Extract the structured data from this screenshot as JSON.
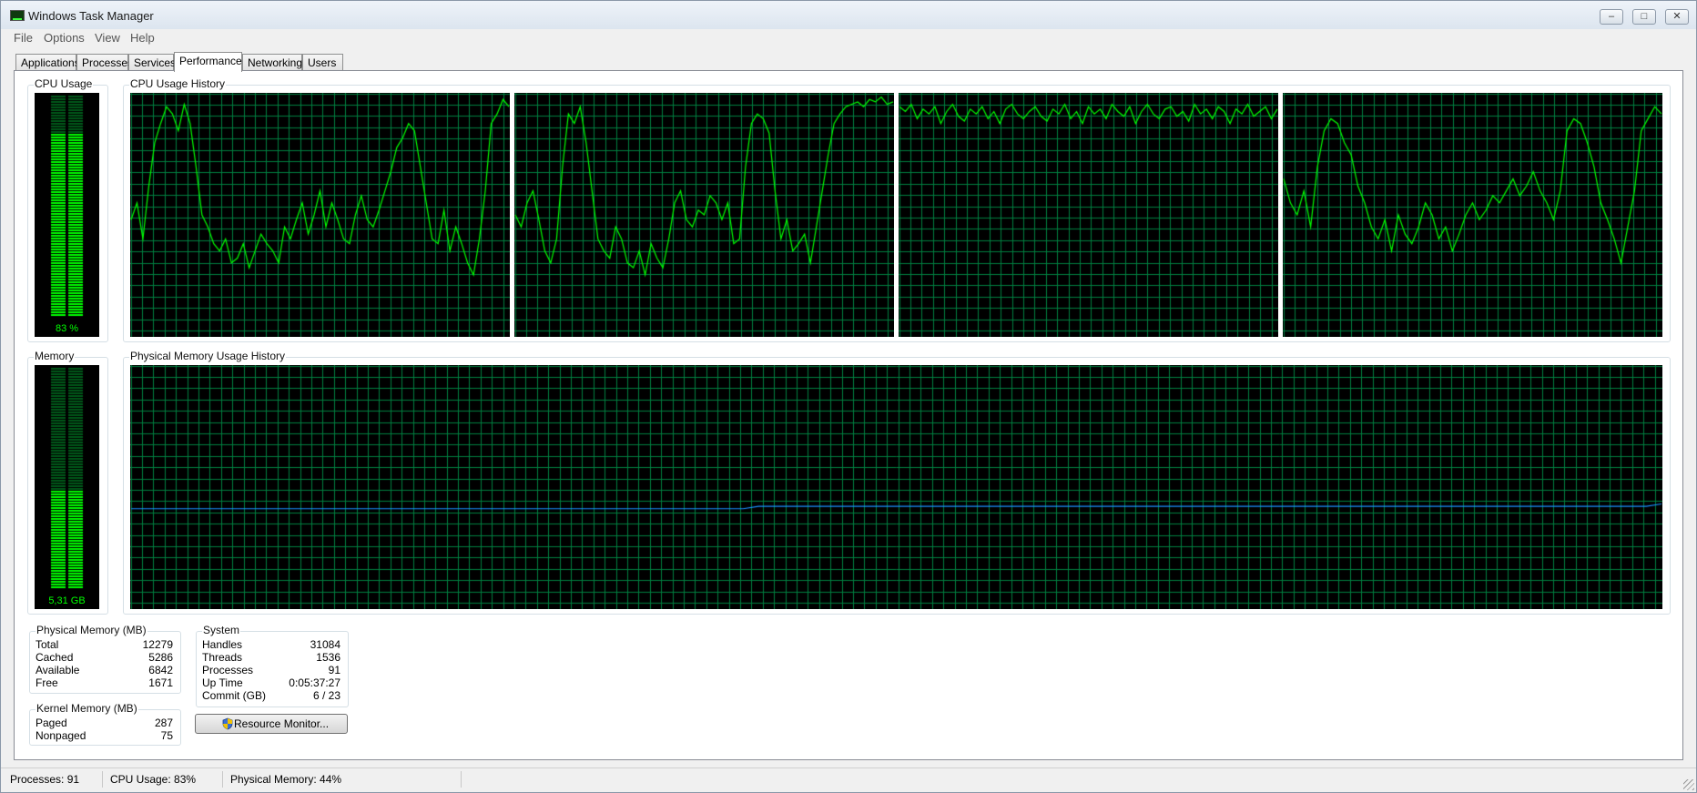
{
  "window": {
    "title": "Windows Task Manager"
  },
  "menu": [
    "File",
    "Options",
    "View",
    "Help"
  ],
  "tabs": [
    {
      "label": "Applications",
      "active": false
    },
    {
      "label": "Processes",
      "active": false
    },
    {
      "label": "Services",
      "active": false
    },
    {
      "label": "Performance",
      "active": true
    },
    {
      "label": "Networking",
      "active": false
    },
    {
      "label": "Users",
      "active": false
    }
  ],
  "cpu": {
    "group_label": "CPU Usage",
    "history_label": "CPU Usage History",
    "meter_text": "83 %",
    "meter_level": 0.83
  },
  "memory": {
    "group_label": "Memory",
    "history_label": "Physical Memory Usage History",
    "meter_text": "5,31 GB",
    "meter_level": 0.44
  },
  "chart_data": [
    {
      "type": "line",
      "name": "cpu-core-1",
      "ylim": [
        0,
        100
      ],
      "values": [
        48,
        55,
        40,
        62,
        80,
        88,
        95,
        92,
        85,
        96,
        88,
        70,
        50,
        45,
        38,
        35,
        40,
        30,
        32,
        38,
        28,
        35,
        42,
        38,
        35,
        30,
        45,
        40,
        48,
        55,
        42,
        50,
        60,
        45,
        55,
        48,
        40,
        38,
        50,
        58,
        48,
        45,
        52,
        60,
        68,
        78,
        82,
        88,
        85,
        70,
        55,
        40,
        38,
        52,
        35,
        45,
        38,
        30,
        25,
        40,
        60,
        88,
        92,
        98,
        95
      ]
    },
    {
      "type": "line",
      "name": "cpu-core-2",
      "ylim": [
        0,
        100
      ],
      "values": [
        50,
        45,
        55,
        60,
        48,
        35,
        30,
        40,
        70,
        92,
        88,
        95,
        80,
        60,
        40,
        35,
        32,
        45,
        40,
        30,
        28,
        35,
        25,
        38,
        32,
        28,
        40,
        55,
        60,
        48,
        45,
        52,
        50,
        58,
        55,
        48,
        55,
        38,
        40,
        70,
        88,
        92,
        90,
        84,
        60,
        40,
        48,
        35,
        38,
        42,
        30,
        45,
        60,
        75,
        88,
        92,
        95,
        96,
        97,
        95,
        98,
        97,
        99,
        96,
        97
      ]
    },
    {
      "type": "line",
      "name": "cpu-core-3",
      "ylim": [
        0,
        100
      ],
      "values": [
        95,
        93,
        96,
        90,
        94,
        92,
        95,
        88,
        93,
        96,
        91,
        89,
        94,
        92,
        95,
        90,
        93,
        88,
        94,
        96,
        92,
        90,
        93,
        95,
        91,
        89,
        94,
        92,
        96,
        90,
        93,
        88,
        95,
        92,
        94,
        90,
        96,
        93,
        91,
        95,
        88,
        93,
        96,
        92,
        90,
        94,
        95,
        91,
        93,
        89,
        96,
        92,
        94,
        90,
        95,
        93,
        88,
        94,
        92,
        96,
        91,
        93,
        95,
        90,
        94
      ]
    },
    {
      "type": "line",
      "name": "cpu-core-4",
      "ylim": [
        0,
        100
      ],
      "values": [
        65,
        55,
        50,
        60,
        45,
        70,
        85,
        90,
        88,
        80,
        75,
        62,
        55,
        45,
        40,
        48,
        35,
        50,
        42,
        38,
        45,
        55,
        50,
        40,
        45,
        35,
        42,
        50,
        55,
        48,
        52,
        58,
        55,
        60,
        65,
        58,
        62,
        68,
        60,
        55,
        48,
        60,
        85,
        90,
        88,
        80,
        70,
        55,
        48,
        40,
        30,
        45,
        60,
        85,
        90,
        95,
        92
      ]
    },
    {
      "type": "line",
      "name": "physical-memory",
      "ylim": [
        0,
        100
      ],
      "values": [
        41,
        41,
        41,
        41,
        41,
        41,
        41,
        41,
        41,
        41,
        41,
        41,
        41,
        41,
        41,
        41,
        41,
        41,
        41,
        41,
        41,
        41,
        41,
        41,
        41,
        41,
        41,
        41,
        41,
        41,
        41,
        41,
        41,
        41,
        41,
        41,
        41,
        41,
        41,
        41,
        41,
        42,
        42,
        42,
        42,
        42,
        42,
        42,
        42,
        42,
        42,
        42,
        42,
        42,
        42,
        42,
        42,
        42,
        42,
        42,
        42,
        42,
        42,
        42,
        42,
        42,
        42,
        42,
        42,
        42,
        42,
        42,
        42,
        42,
        42,
        42,
        42,
        42,
        42,
        42,
        42,
        42,
        42,
        42,
        42,
        42,
        42,
        42,
        42,
        42,
        42,
        42,
        42,
        42,
        42,
        42,
        42,
        42,
        42,
        42,
        43
      ]
    }
  ],
  "physical_memory": {
    "title": "Physical Memory (MB)",
    "rows": [
      {
        "label": "Total",
        "value": "12279"
      },
      {
        "label": "Cached",
        "value": "5286"
      },
      {
        "label": "Available",
        "value": "6842"
      },
      {
        "label": "Free",
        "value": "1671"
      }
    ]
  },
  "kernel_memory": {
    "title": "Kernel Memory (MB)",
    "rows": [
      {
        "label": "Paged",
        "value": "287"
      },
      {
        "label": "Nonpaged",
        "value": "75"
      }
    ]
  },
  "system": {
    "title": "System",
    "rows": [
      {
        "label": "Handles",
        "value": "31084"
      },
      {
        "label": "Threads",
        "value": "1536"
      },
      {
        "label": "Processes",
        "value": "91"
      },
      {
        "label": "Up Time",
        "value": "0:05:37:27"
      },
      {
        "label": "Commit (GB)",
        "value": "6 / 23"
      }
    ]
  },
  "resource_monitor_label": "Resource Monitor...",
  "status": {
    "processes": "Processes: 91",
    "cpu": "CPU Usage: 83%",
    "memory": "Physical Memory: 44%"
  },
  "colors": {
    "grid": "#008040",
    "cpu_line": "#00ff00",
    "mem_line": "#1a8fff",
    "meter_on": "#00ff00",
    "meter_off": "#005a1a"
  },
  "icons": {
    "window": "task-manager-icon",
    "minimize": "minimize-icon",
    "maximize": "maximize-icon",
    "close": "close-icon",
    "resource_monitor": "shield-icon"
  }
}
